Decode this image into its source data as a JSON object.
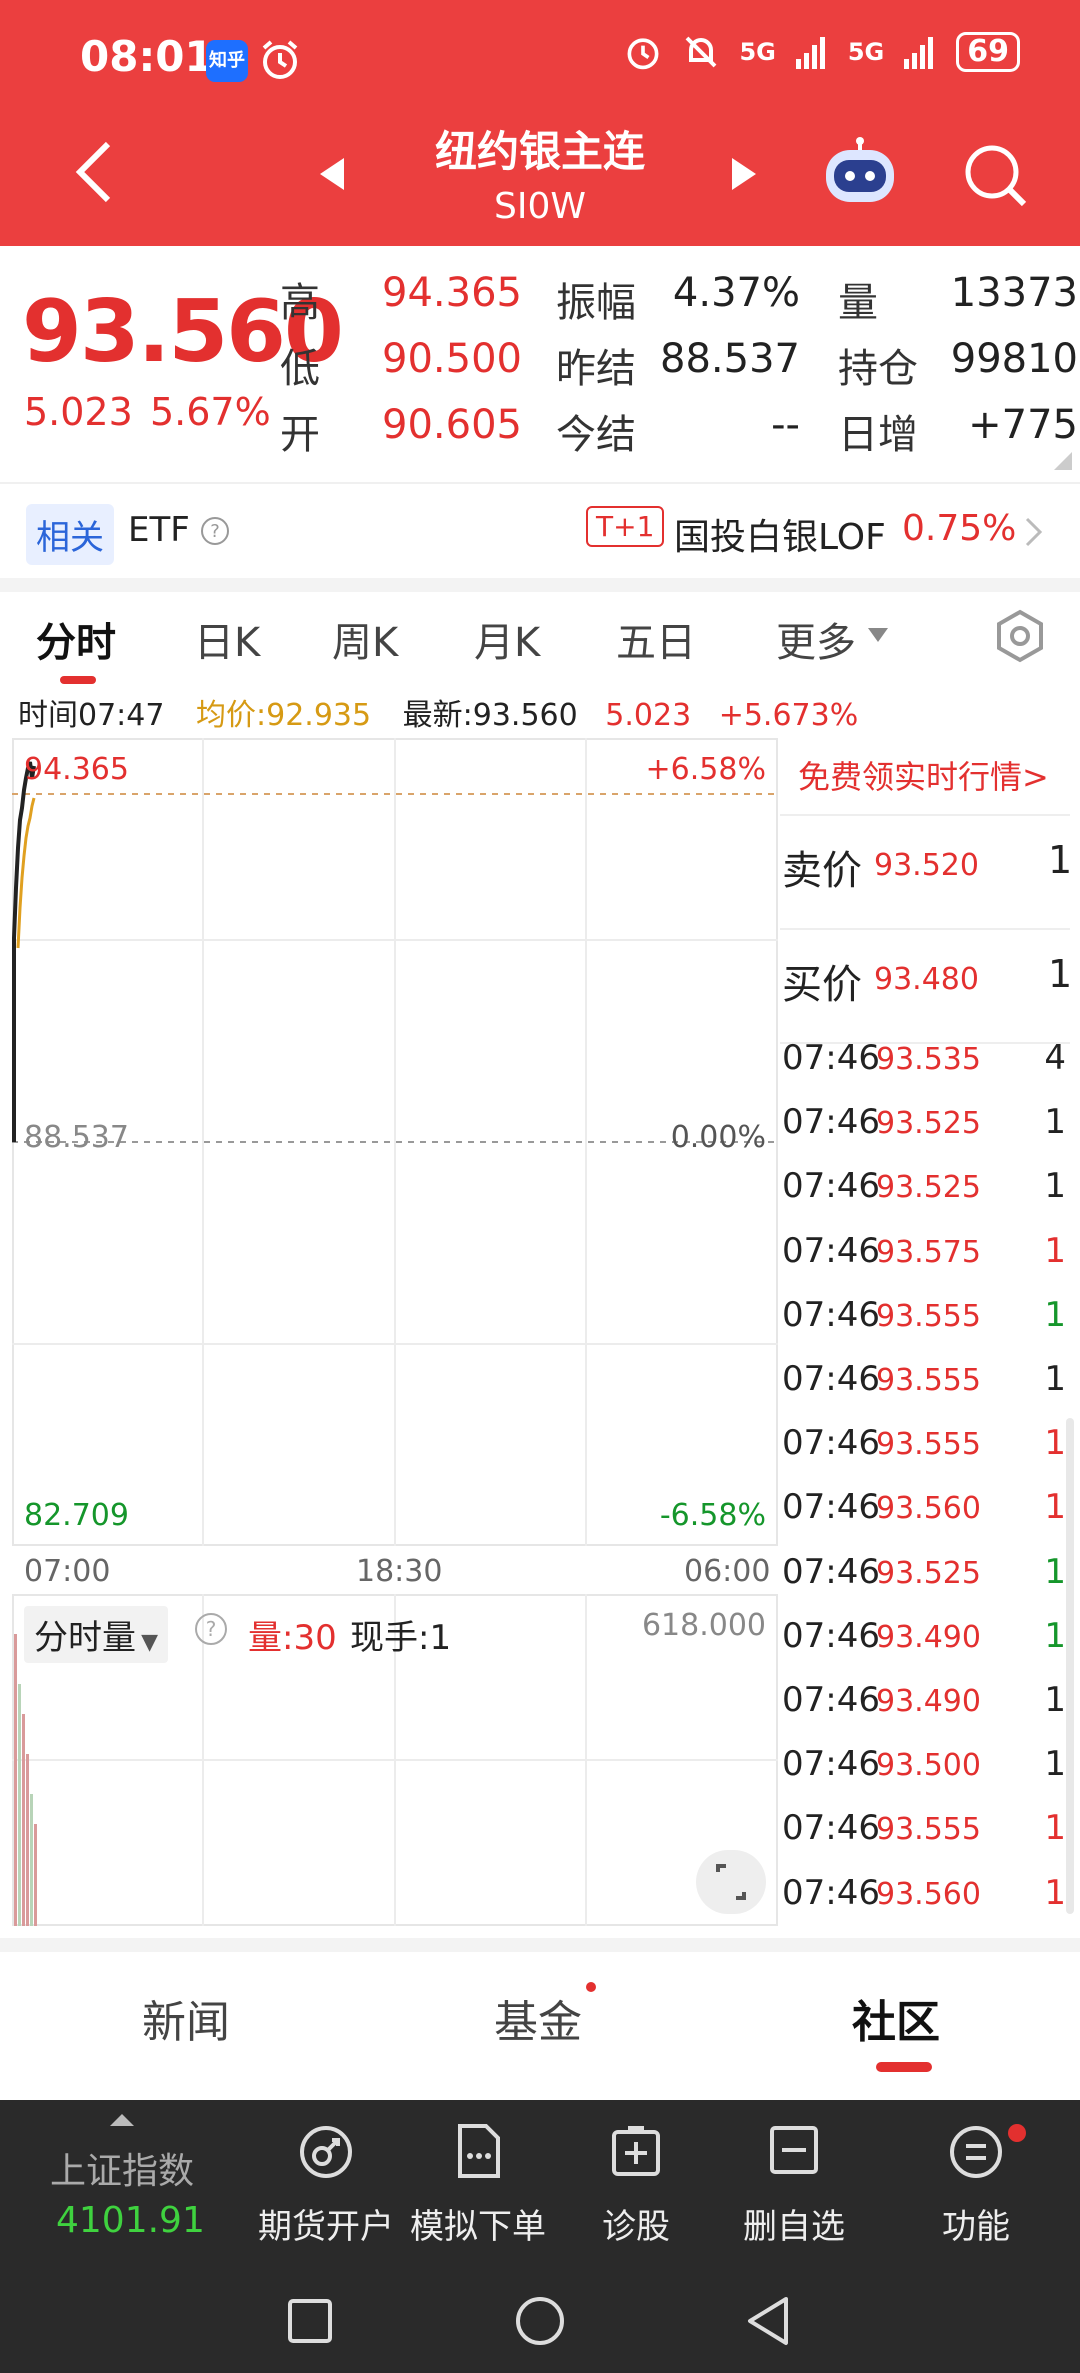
{
  "status": {
    "time": "08:01",
    "zhihu": "知乎",
    "signal1": "5G",
    "signal2": "5G",
    "battery": "69"
  },
  "header": {
    "title": "纽约银主连",
    "code": "SI0W"
  },
  "quote": {
    "price": "93.560",
    "change": "5.023",
    "change_pct": "5.67%",
    "high_label": "高",
    "high": "94.365",
    "low_label": "低",
    "low": "90.500",
    "open_label": "开",
    "open": "90.605",
    "amp_label": "振幅",
    "amp": "4.37%",
    "prev_settle_label": "昨结",
    "prev_settle": "88.537",
    "today_settle_label": "今结",
    "today_settle": "--",
    "vol_label": "量",
    "vol": "13373",
    "oi_label": "持仓",
    "oi": "99810",
    "daily_inc_label": "日增",
    "daily_inc": "+775"
  },
  "etf": {
    "related": "相关",
    "etf": "ETF",
    "t1": "T+1",
    "fund": "国投白银LOF",
    "fund_pct": "0.75%"
  },
  "tabs": [
    "分时",
    "日K",
    "周K",
    "月K",
    "五日",
    "更多"
  ],
  "info": {
    "time": "时间07:47",
    "avg": "均价:92.935",
    "latest": "最新:93.560",
    "chg": "5.023",
    "pct": "+5.673%"
  },
  "chart": {
    "top_price": "94.365",
    "top_pct": "+6.58%",
    "mid_price": "88.537",
    "mid_pct": "0.00%",
    "bot_price": "82.709",
    "bot_pct": "-6.58%",
    "x_start": "07:00",
    "x_mid": "18:30",
    "x_end": "06:00",
    "vol_title": "分时量",
    "vol_now": "量:30",
    "hand_now": "现手:1",
    "vol_max": "618.000"
  },
  "panel": {
    "promo": "免费领实时行情>",
    "sell_label": "卖价",
    "sell_price": "93.520",
    "sell_qty": "1",
    "buy_label": "买价",
    "buy_price": "93.480",
    "buy_qty": "1",
    "ticks": [
      {
        "t": "07:46",
        "p": "93.535",
        "v": "4",
        "c": "black"
      },
      {
        "t": "07:46",
        "p": "93.525",
        "v": "1",
        "c": "black"
      },
      {
        "t": "07:46",
        "p": "93.525",
        "v": "1",
        "c": "black"
      },
      {
        "t": "07:46",
        "p": "93.575",
        "v": "1",
        "c": "red"
      },
      {
        "t": "07:46",
        "p": "93.555",
        "v": "1",
        "c": "green"
      },
      {
        "t": "07:46",
        "p": "93.555",
        "v": "1",
        "c": "black"
      },
      {
        "t": "07:46",
        "p": "93.555",
        "v": "1",
        "c": "red"
      },
      {
        "t": "07:46",
        "p": "93.560",
        "v": "1",
        "c": "red"
      },
      {
        "t": "07:46",
        "p": "93.525",
        "v": "1",
        "c": "green"
      },
      {
        "t": "07:46",
        "p": "93.490",
        "v": "1",
        "c": "green"
      },
      {
        "t": "07:46",
        "p": "93.490",
        "v": "1",
        "c": "black"
      },
      {
        "t": "07:46",
        "p": "93.500",
        "v": "1",
        "c": "black"
      },
      {
        "t": "07:46",
        "p": "93.555",
        "v": "1",
        "c": "red"
      },
      {
        "t": "07:46",
        "p": "93.560",
        "v": "1",
        "c": "red"
      }
    ]
  },
  "news_tabs": [
    "新闻",
    "基金",
    "社区"
  ],
  "toolbar": {
    "index_name": "上证指数",
    "index_value": "4101.91",
    "items": [
      "期货开户",
      "模拟下单",
      "诊股",
      "删自选",
      "功能"
    ]
  },
  "colors": {
    "header_red": "#eb3f3f",
    "up_red": "#e3302f",
    "down_green": "#15962b",
    "avg_line": "#e0a020",
    "toolbar_bg": "#2a2a2a"
  }
}
